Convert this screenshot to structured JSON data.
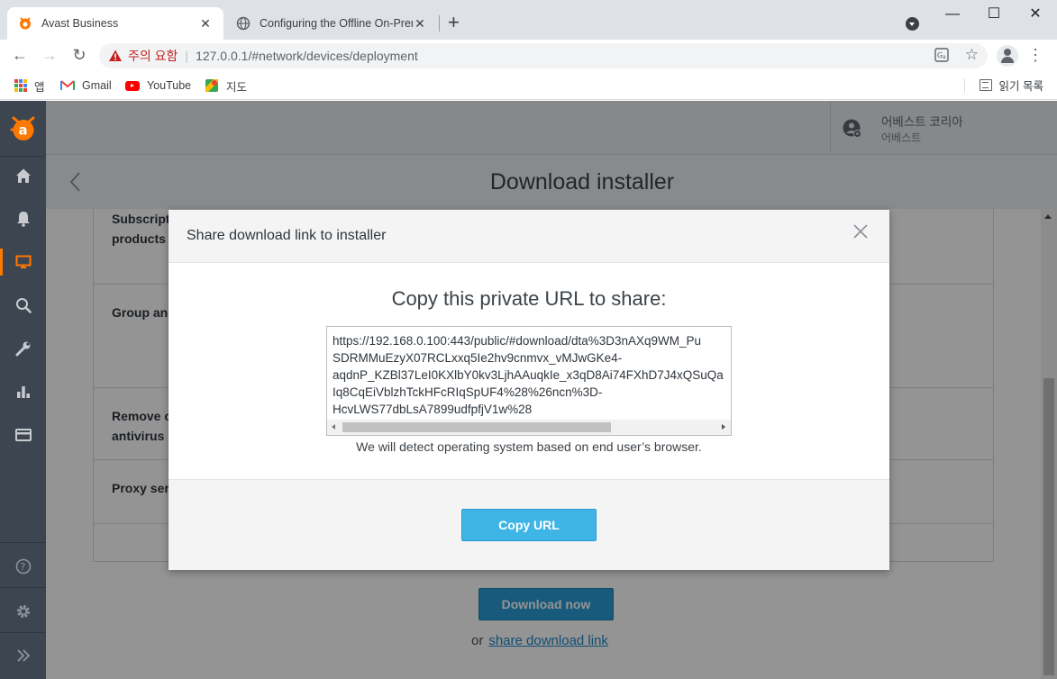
{
  "browser": {
    "tabs": [
      {
        "title": "Avast Business",
        "active": true
      },
      {
        "title": "Configuring the Offline On-Prem",
        "active": false
      }
    ],
    "security_warning": "주의 요함",
    "url": "127.0.0.1/#network/devices/deployment",
    "bookmarks": [
      {
        "label": "앱",
        "icon": "apps-icon"
      },
      {
        "label": "Gmail",
        "icon": "gmail-icon"
      },
      {
        "label": "YouTube",
        "icon": "youtube-icon"
      },
      {
        "label": "지도",
        "icon": "maps-icon"
      }
    ],
    "reading_list": "읽기 목록"
  },
  "app": {
    "account": {
      "name": "어베스트 코리아",
      "sub": "어베스트"
    },
    "page_title": "Download installer",
    "accent_color": "#ff7800",
    "sidebar": [
      "home-icon",
      "notifications-icon",
      "devices-icon",
      "search-icon",
      "tools-icon",
      "reports-icon",
      "subscriptions-icon",
      "help-icon",
      "settings-icon",
      "expand-icon"
    ],
    "rows": [
      {
        "label_line1": "Subscript",
        "label_line2": "products"
      },
      {
        "label_line1": "Group an",
        "label_line2": ""
      },
      {
        "label_line1": "Remove c",
        "label_line2": "antivirus"
      },
      {
        "label_line1": "Proxy ser",
        "label_line2": ""
      }
    ],
    "download_button": "Download now",
    "or_text": "or",
    "share_link": "share download link"
  },
  "modal": {
    "title": "Share download link to installer",
    "heading": "Copy this private URL to share:",
    "url_lines": [
      "https://192.168.0.100:443/public/#download/dta%3D3nAXq9WM_Pu",
      "SDRMMuEzyX07RCLxxq5Ie2hv9cnmvx_vMJwGKe4-",
      "aqdnP_KZBl37LeI0KXlbY0kv3LjhAAuqkIe_x3qD8Ai74FXhD7J4xQSuQa",
      "Iq8CqEiVblzhTckHFcRIqSpUF4%28%26ncn%3D-",
      "HcvLWS77dbLsA7899udfpfjV1w%28"
    ],
    "note": "We will detect operating system based on end user’s browser.",
    "copy_button": "Copy URL"
  }
}
